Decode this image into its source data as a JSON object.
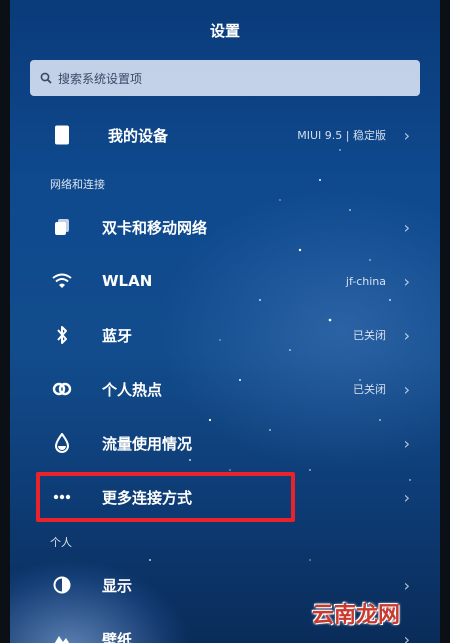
{
  "header": {
    "title": "设置"
  },
  "search": {
    "placeholder": "搜索系统设置项"
  },
  "device": {
    "label": "我的设备",
    "value": "MIUI 9.5 | 稳定版"
  },
  "sections": {
    "network": "网络和连接",
    "personal": "个人"
  },
  "network_items": [
    {
      "label": "双卡和移动网络",
      "value": "",
      "icon": "sim-card-icon"
    },
    {
      "label": "WLAN",
      "value": "jf-china",
      "icon": "wifi-icon"
    },
    {
      "label": "蓝牙",
      "value": "已关闭",
      "icon": "bluetooth-icon"
    },
    {
      "label": "个人热点",
      "value": "已关闭",
      "icon": "hotspot-icon"
    },
    {
      "label": "流量使用情况",
      "value": "",
      "icon": "data-usage-icon"
    },
    {
      "label": "更多连接方式",
      "value": "",
      "icon": "more-dots-icon"
    }
  ],
  "personal_items": [
    {
      "label": "显示",
      "icon": "display-icon"
    },
    {
      "label": "壁纸",
      "icon": "wallpaper-icon"
    }
  ],
  "watermark": "云南龙网",
  "colors": {
    "highlight": "#e8232c",
    "search_bg": "#ebf2ff"
  }
}
